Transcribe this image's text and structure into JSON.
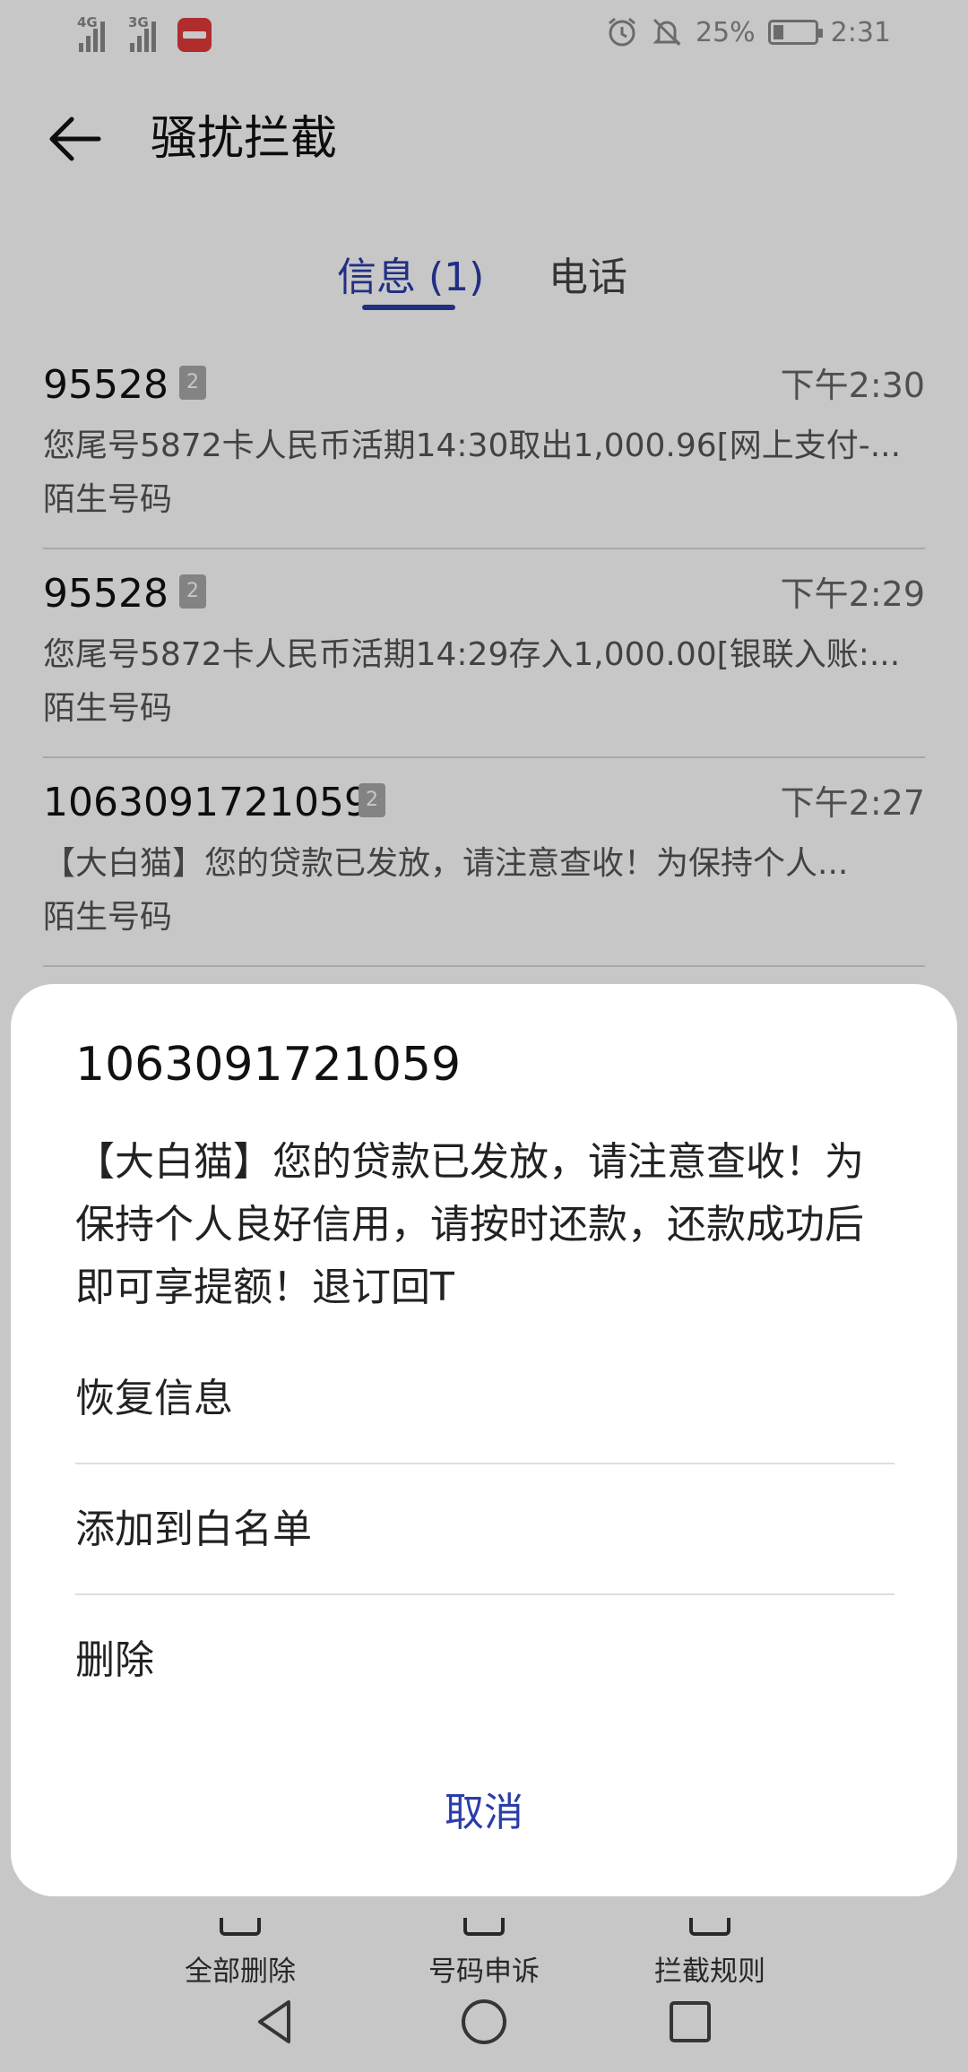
{
  "status_bar": {
    "signal_1_label": "4G",
    "signal_2_label": "3G",
    "battery": "25%",
    "battery_level": 0.25,
    "time": "2:31",
    "icons": [
      "signal-4g-icon",
      "signal-3g-icon",
      "app-notification-icon",
      "alarm-icon",
      "mute-bell-icon",
      "battery-icon"
    ]
  },
  "header": {
    "title": "骚扰拦截",
    "back_icon": "arrow-left-icon"
  },
  "tabs": [
    {
      "label": "信息 (1)",
      "active": true
    },
    {
      "label": "电话",
      "active": false
    }
  ],
  "messages": [
    {
      "sender": "95528",
      "sim": "2",
      "time": "下午2:30",
      "preview": "您尾号5872卡人民币活期14:30取出1,000.96[网上支付-...",
      "label": "陌生号码"
    },
    {
      "sender": "95528",
      "sim": "2",
      "time": "下午2:29",
      "preview": "您尾号5872卡人民币活期14:29存入1,000.00[银联入账:...",
      "label": "陌生号码"
    },
    {
      "sender": "1063091721059",
      "sim": "2",
      "time": "下午2:27",
      "preview": "【大白猫】您的贷款已发放，请注意查收！为保持个人...",
      "label": "陌生号码"
    }
  ],
  "bottom_actions": [
    {
      "label": "全部删除",
      "icon": "delete-all-icon"
    },
    {
      "label": "号码申诉",
      "icon": "appeal-icon"
    },
    {
      "label": "拦截规则",
      "icon": "rules-icon"
    }
  ],
  "nav_bar": {
    "icons": [
      "back-triangle-icon",
      "home-circle-icon",
      "recents-square-icon"
    ]
  },
  "dialog": {
    "title": "1063091721059",
    "body": "【大白猫】您的贷款已发放，请注意查收！为保持个人良好信用，请按时还款，还款成功后即可享提额！退订回T",
    "options": [
      "恢复信息",
      "添加到白名单",
      "删除"
    ],
    "cancel": "取消"
  },
  "colors": {
    "accent": "#2b3da8",
    "scrim": "rgba(0,0,0,0.22)"
  }
}
